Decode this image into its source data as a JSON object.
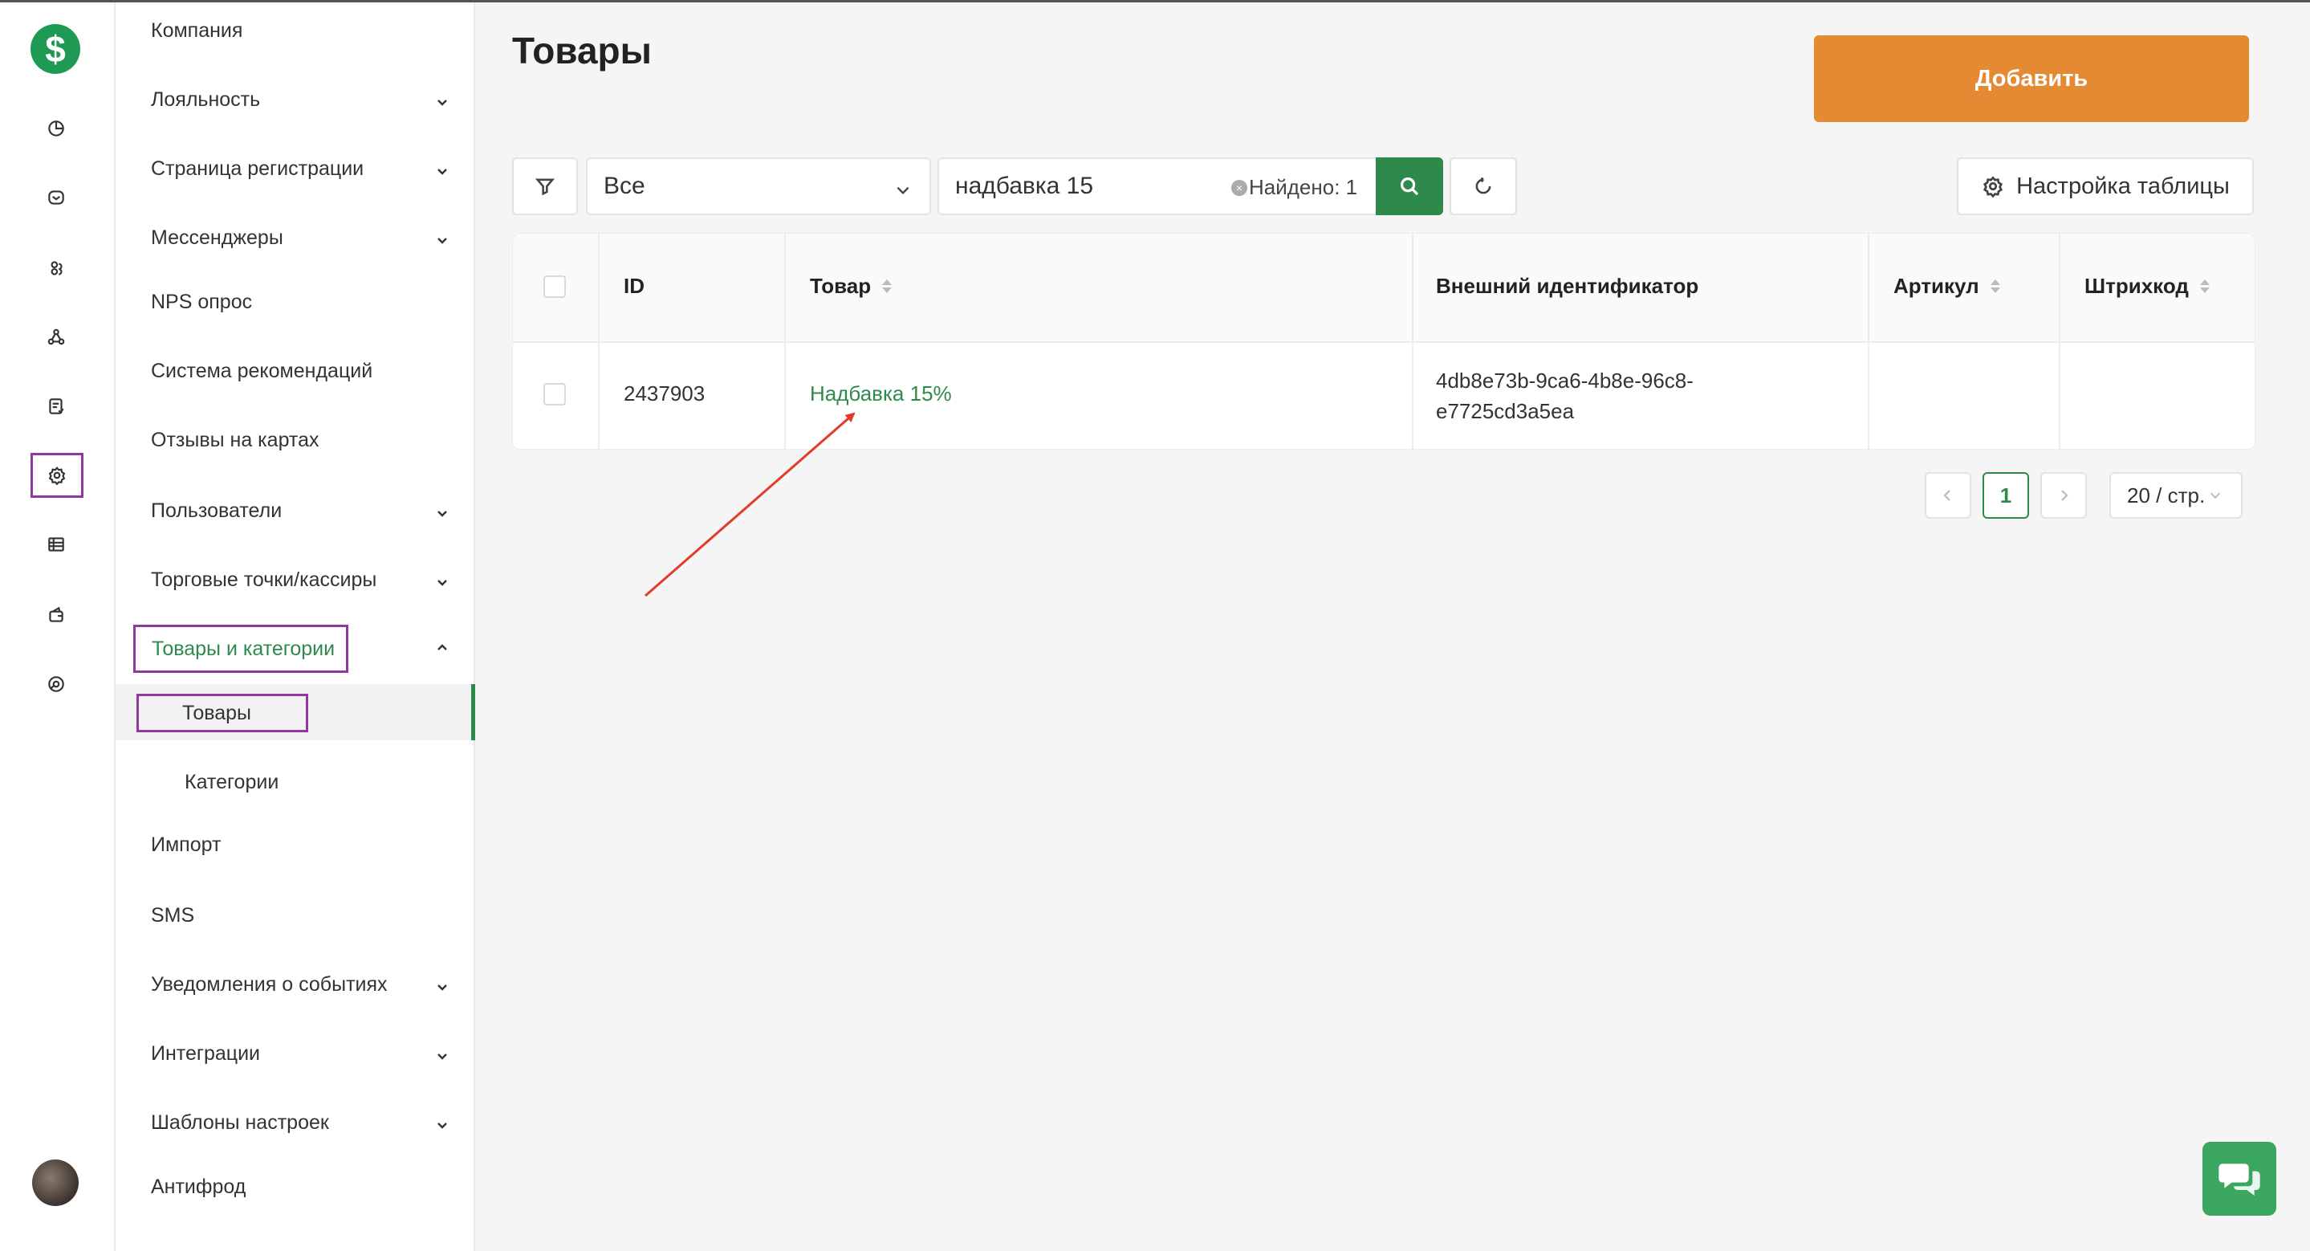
{
  "page": {
    "title": "Товары"
  },
  "toolbar": {
    "add_label": "Добавить",
    "settings_label": "Настройка таблицы"
  },
  "filter": {
    "select_value": "Все",
    "search_value": "надбавка 15",
    "found_label": "Найдено: 1",
    "clear_glyph": "×"
  },
  "menu": {
    "items": [
      {
        "label": "Компания",
        "has_chevron": false
      },
      {
        "label": "Лояльность",
        "has_chevron": true
      },
      {
        "label": "Страница регистрации",
        "has_chevron": true
      },
      {
        "label": "Мессенджеры",
        "has_chevron": true
      },
      {
        "label": "NPS опрос",
        "has_chevron": false
      },
      {
        "label": "Система рекомендаций",
        "has_chevron": false
      },
      {
        "label": "Отзывы на картах",
        "has_chevron": false
      },
      {
        "label": "Пользователи",
        "has_chevron": true
      },
      {
        "label": "Торговые точки/кассиры",
        "has_chevron": true
      },
      {
        "label": "Товары и категории",
        "has_chevron": true,
        "expanded": true
      },
      {
        "label": "Товары",
        "sub": true,
        "active": true
      },
      {
        "label": "Категории",
        "sub": true
      },
      {
        "label": "Импорт",
        "has_chevron": false
      },
      {
        "label": "SMS",
        "has_chevron": false
      },
      {
        "label": "Уведомления о событиях",
        "has_chevron": true
      },
      {
        "label": "Интеграции",
        "has_chevron": true
      },
      {
        "label": "Шаблоны настроек",
        "has_chevron": true
      },
      {
        "label": "Антифрод",
        "has_chevron": false
      }
    ]
  },
  "rail": {
    "logo_glyph": "$",
    "icons": [
      "dashboard-icon",
      "mail-icon",
      "users-icon",
      "flow-icon",
      "reports-icon",
      "settings-icon",
      "table-icon",
      "wallet-icon",
      "analytics-icon"
    ],
    "active_icon": "settings-icon"
  },
  "table": {
    "headers": {
      "id": "ID",
      "product": "Товар",
      "external_id": "Внешний идентификатор",
      "sku": "Артикул",
      "barcode": "Штрихкод"
    },
    "rows": [
      {
        "id": "2437903",
        "product": "Надбавка 15%",
        "external_id_line1": "4db8e73b-9ca6-4b8e-96c8-",
        "external_id_line2": "e7725cd3a5ea",
        "sku": "",
        "barcode": ""
      }
    ]
  },
  "pagination": {
    "current_page": "1",
    "page_size": "20 / стр."
  },
  "colors": {
    "accent_green": "#2e8a4c",
    "add_orange": "#e48a32",
    "highlight_purple": "#8e3a9e",
    "annotation_red": "#e23b2a"
  }
}
